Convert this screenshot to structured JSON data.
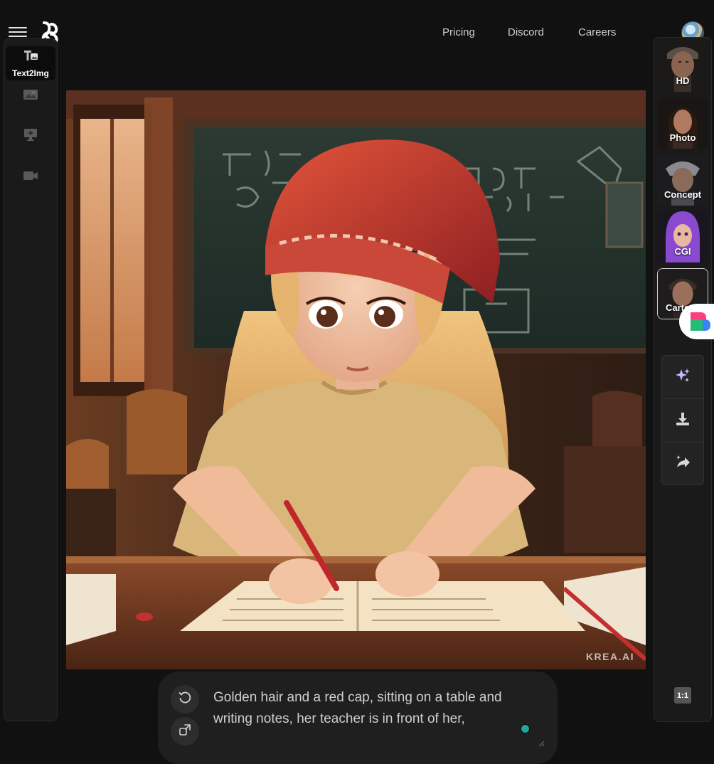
{
  "header": {
    "nav": [
      "Pricing",
      "Discord",
      "Careers"
    ]
  },
  "left_rail": {
    "items": [
      {
        "label": "Text2Img",
        "icon": "text-to-image-icon",
        "active": true
      },
      {
        "label": "",
        "icon": "image-icon"
      },
      {
        "label": "",
        "icon": "upscale-icon"
      },
      {
        "label": "",
        "icon": "video-camera-icon"
      }
    ]
  },
  "main_image": {
    "watermark": "KREA.AI"
  },
  "styles": [
    {
      "label": "HD"
    },
    {
      "label": "Photo"
    },
    {
      "label": "Concept"
    },
    {
      "label": "CGI"
    },
    {
      "label": "Carto",
      "selected": true
    }
  ],
  "actions": [
    {
      "icon": "sparkles-icon"
    },
    {
      "icon": "download-icon"
    },
    {
      "icon": "magic-share-icon"
    }
  ],
  "aspect_ratio": "1:1",
  "prompt": {
    "text": "Golden hair and a red cap, sitting on a table and writing notes, her teacher is in front of her,"
  },
  "colors": {
    "background": "#111111",
    "panel": "#1a1a1a",
    "accent_dot": "#1fa89a"
  }
}
